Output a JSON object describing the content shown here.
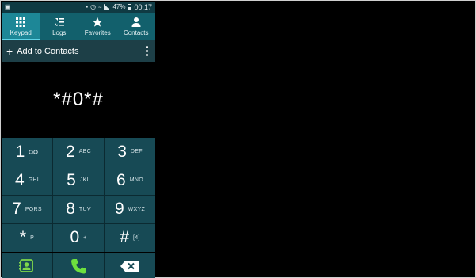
{
  "status_bar": {
    "battery": "47%",
    "time": "00:17"
  },
  "tabs": [
    {
      "label": "Keypad",
      "icon": "keypad-icon",
      "active": true
    },
    {
      "label": "Logs",
      "icon": "logs-icon",
      "active": false
    },
    {
      "label": "Favorites",
      "icon": "star-icon",
      "active": false
    },
    {
      "label": "Contacts",
      "icon": "contacts-icon",
      "active": false
    }
  ],
  "action_bar": {
    "add_label": "Add to Contacts"
  },
  "display": {
    "number": "*#0*#"
  },
  "keypad": [
    {
      "digit": "1",
      "letters": "",
      "icon": "voicemail-icon"
    },
    {
      "digit": "2",
      "letters": "ABC"
    },
    {
      "digit": "3",
      "letters": "DEF"
    },
    {
      "digit": "4",
      "letters": "GHI"
    },
    {
      "digit": "5",
      "letters": "JKL"
    },
    {
      "digit": "6",
      "letters": "MNO"
    },
    {
      "digit": "7",
      "letters": "PQRS"
    },
    {
      "digit": "8",
      "letters": "TUV"
    },
    {
      "digit": "9",
      "letters": "WXYZ"
    },
    {
      "digit": "*",
      "letters": "P"
    },
    {
      "digit": "0",
      "letters": "+"
    },
    {
      "digit": "#",
      "letters": "[4]"
    }
  ],
  "bottom_actions": [
    {
      "icon": "add-contact-icon",
      "color": "#7fd84a"
    },
    {
      "icon": "phone-call-icon",
      "color": "#6ee03e"
    },
    {
      "icon": "backspace-icon",
      "color": "#ffffff"
    }
  ],
  "colors": {
    "tab_bar": "#12606c",
    "tab_active": "#1d8797",
    "action_bar": "#1d3f47",
    "key_background": "#174a55",
    "call_green": "#6ee03e"
  }
}
